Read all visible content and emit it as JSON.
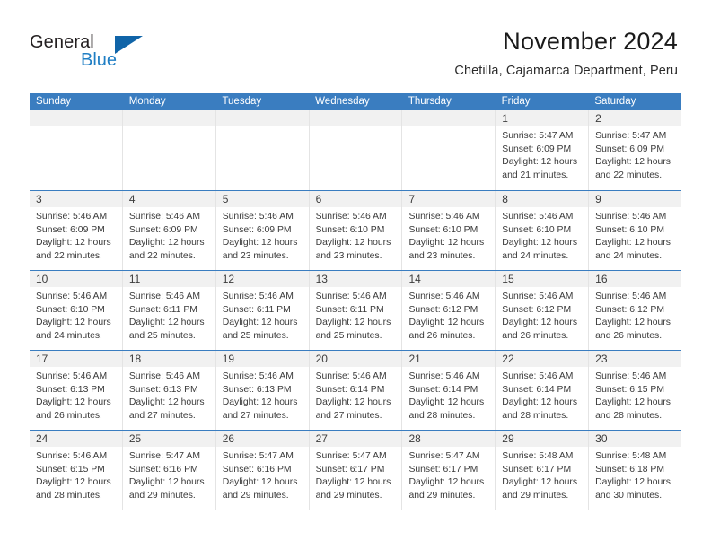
{
  "brand": {
    "word_top": "General",
    "word_bottom": "Blue",
    "accent_color": "#1064a8",
    "blue_text_color": "#1f7ec4"
  },
  "header": {
    "month_title": "November 2024",
    "location": "Chetilla, Cajamarca Department, Peru"
  },
  "calendar": {
    "header_bg": "#3a7dc0",
    "weekdays": [
      "Sunday",
      "Monday",
      "Tuesday",
      "Wednesday",
      "Thursday",
      "Friday",
      "Saturday"
    ],
    "weeks": [
      [
        {
          "day": "",
          "lines": []
        },
        {
          "day": "",
          "lines": []
        },
        {
          "day": "",
          "lines": []
        },
        {
          "day": "",
          "lines": []
        },
        {
          "day": "",
          "lines": []
        },
        {
          "day": "1",
          "lines": [
            "Sunrise: 5:47 AM",
            "Sunset: 6:09 PM",
            "Daylight: 12 hours",
            "and 21 minutes."
          ]
        },
        {
          "day": "2",
          "lines": [
            "Sunrise: 5:47 AM",
            "Sunset: 6:09 PM",
            "Daylight: 12 hours",
            "and 22 minutes."
          ]
        }
      ],
      [
        {
          "day": "3",
          "lines": [
            "Sunrise: 5:46 AM",
            "Sunset: 6:09 PM",
            "Daylight: 12 hours",
            "and 22 minutes."
          ]
        },
        {
          "day": "4",
          "lines": [
            "Sunrise: 5:46 AM",
            "Sunset: 6:09 PM",
            "Daylight: 12 hours",
            "and 22 minutes."
          ]
        },
        {
          "day": "5",
          "lines": [
            "Sunrise: 5:46 AM",
            "Sunset: 6:09 PM",
            "Daylight: 12 hours",
            "and 23 minutes."
          ]
        },
        {
          "day": "6",
          "lines": [
            "Sunrise: 5:46 AM",
            "Sunset: 6:10 PM",
            "Daylight: 12 hours",
            "and 23 minutes."
          ]
        },
        {
          "day": "7",
          "lines": [
            "Sunrise: 5:46 AM",
            "Sunset: 6:10 PM",
            "Daylight: 12 hours",
            "and 23 minutes."
          ]
        },
        {
          "day": "8",
          "lines": [
            "Sunrise: 5:46 AM",
            "Sunset: 6:10 PM",
            "Daylight: 12 hours",
            "and 24 minutes."
          ]
        },
        {
          "day": "9",
          "lines": [
            "Sunrise: 5:46 AM",
            "Sunset: 6:10 PM",
            "Daylight: 12 hours",
            "and 24 minutes."
          ]
        }
      ],
      [
        {
          "day": "10",
          "lines": [
            "Sunrise: 5:46 AM",
            "Sunset: 6:10 PM",
            "Daylight: 12 hours",
            "and 24 minutes."
          ]
        },
        {
          "day": "11",
          "lines": [
            "Sunrise: 5:46 AM",
            "Sunset: 6:11 PM",
            "Daylight: 12 hours",
            "and 25 minutes."
          ]
        },
        {
          "day": "12",
          "lines": [
            "Sunrise: 5:46 AM",
            "Sunset: 6:11 PM",
            "Daylight: 12 hours",
            "and 25 minutes."
          ]
        },
        {
          "day": "13",
          "lines": [
            "Sunrise: 5:46 AM",
            "Sunset: 6:11 PM",
            "Daylight: 12 hours",
            "and 25 minutes."
          ]
        },
        {
          "day": "14",
          "lines": [
            "Sunrise: 5:46 AM",
            "Sunset: 6:12 PM",
            "Daylight: 12 hours",
            "and 26 minutes."
          ]
        },
        {
          "day": "15",
          "lines": [
            "Sunrise: 5:46 AM",
            "Sunset: 6:12 PM",
            "Daylight: 12 hours",
            "and 26 minutes."
          ]
        },
        {
          "day": "16",
          "lines": [
            "Sunrise: 5:46 AM",
            "Sunset: 6:12 PM",
            "Daylight: 12 hours",
            "and 26 minutes."
          ]
        }
      ],
      [
        {
          "day": "17",
          "lines": [
            "Sunrise: 5:46 AM",
            "Sunset: 6:13 PM",
            "Daylight: 12 hours",
            "and 26 minutes."
          ]
        },
        {
          "day": "18",
          "lines": [
            "Sunrise: 5:46 AM",
            "Sunset: 6:13 PM",
            "Daylight: 12 hours",
            "and 27 minutes."
          ]
        },
        {
          "day": "19",
          "lines": [
            "Sunrise: 5:46 AM",
            "Sunset: 6:13 PM",
            "Daylight: 12 hours",
            "and 27 minutes."
          ]
        },
        {
          "day": "20",
          "lines": [
            "Sunrise: 5:46 AM",
            "Sunset: 6:14 PM",
            "Daylight: 12 hours",
            "and 27 minutes."
          ]
        },
        {
          "day": "21",
          "lines": [
            "Sunrise: 5:46 AM",
            "Sunset: 6:14 PM",
            "Daylight: 12 hours",
            "and 28 minutes."
          ]
        },
        {
          "day": "22",
          "lines": [
            "Sunrise: 5:46 AM",
            "Sunset: 6:14 PM",
            "Daylight: 12 hours",
            "and 28 minutes."
          ]
        },
        {
          "day": "23",
          "lines": [
            "Sunrise: 5:46 AM",
            "Sunset: 6:15 PM",
            "Daylight: 12 hours",
            "and 28 minutes."
          ]
        }
      ],
      [
        {
          "day": "24",
          "lines": [
            "Sunrise: 5:46 AM",
            "Sunset: 6:15 PM",
            "Daylight: 12 hours",
            "and 28 minutes."
          ]
        },
        {
          "day": "25",
          "lines": [
            "Sunrise: 5:47 AM",
            "Sunset: 6:16 PM",
            "Daylight: 12 hours",
            "and 29 minutes."
          ]
        },
        {
          "day": "26",
          "lines": [
            "Sunrise: 5:47 AM",
            "Sunset: 6:16 PM",
            "Daylight: 12 hours",
            "and 29 minutes."
          ]
        },
        {
          "day": "27",
          "lines": [
            "Sunrise: 5:47 AM",
            "Sunset: 6:17 PM",
            "Daylight: 12 hours",
            "and 29 minutes."
          ]
        },
        {
          "day": "28",
          "lines": [
            "Sunrise: 5:47 AM",
            "Sunset: 6:17 PM",
            "Daylight: 12 hours",
            "and 29 minutes."
          ]
        },
        {
          "day": "29",
          "lines": [
            "Sunrise: 5:48 AM",
            "Sunset: 6:17 PM",
            "Daylight: 12 hours",
            "and 29 minutes."
          ]
        },
        {
          "day": "30",
          "lines": [
            "Sunrise: 5:48 AM",
            "Sunset: 6:18 PM",
            "Daylight: 12 hours",
            "and 30 minutes."
          ]
        }
      ]
    ]
  }
}
